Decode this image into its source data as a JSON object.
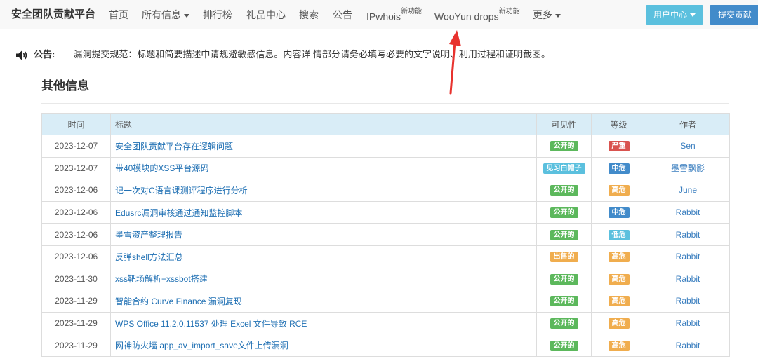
{
  "brand": "安全团队贡献平台",
  "nav": [
    {
      "label": "首页",
      "sup": "",
      "caret": false
    },
    {
      "label": "所有信息",
      "sup": "",
      "caret": true
    },
    {
      "label": "排行榜",
      "sup": "",
      "caret": false
    },
    {
      "label": "礼品中心",
      "sup": "",
      "caret": false
    },
    {
      "label": "搜索",
      "sup": "",
      "caret": false
    },
    {
      "label": "公告",
      "sup": "",
      "caret": false
    },
    {
      "label": "IPwhois",
      "sup": "新功能",
      "caret": false
    },
    {
      "label": "WooYun drops",
      "sup": "新功能",
      "caret": false
    },
    {
      "label": "更多",
      "sup": "",
      "caret": true
    }
  ],
  "user_center_label": "用户中心",
  "submit_label": "提交贡献",
  "notice": {
    "label": "公告:",
    "text": "漏洞提交规范：标题和简要描述中请规避敏感信息。内容详 情部分请务必填写必要的文字说明、利用过程和证明截图。"
  },
  "section_title": "其他信息",
  "table": {
    "headers": {
      "time": "时间",
      "title": "标题",
      "visibility": "可见性",
      "level": "等级",
      "author": "作者"
    },
    "rows": [
      {
        "time": "2023-12-07",
        "title": "安全团队贡献平台存在逻辑问题",
        "visibility": "公开的",
        "visibility_color": "#5cb85c",
        "level": "严重",
        "level_color": "#d9534f",
        "author": "Sen"
      },
      {
        "time": "2023-12-07",
        "title": "带40模块的XSS平台源码",
        "visibility": "见习白帽子",
        "visibility_color": "#5bc0de",
        "level": "中危",
        "level_color": "#428bca",
        "author": "墨雪飘影"
      },
      {
        "time": "2023-12-06",
        "title": "记一次对C语言课测评程序进行分析",
        "visibility": "公开的",
        "visibility_color": "#5cb85c",
        "level": "高危",
        "level_color": "#f0ad4e",
        "author": "June"
      },
      {
        "time": "2023-12-06",
        "title": "Edusrc漏洞审核通过通知监控脚本",
        "visibility": "公开的",
        "visibility_color": "#5cb85c",
        "level": "中危",
        "level_color": "#428bca",
        "author": "Rabbit"
      },
      {
        "time": "2023-12-06",
        "title": "墨雪资产整理报告",
        "visibility": "公开的",
        "visibility_color": "#5cb85c",
        "level": "低危",
        "level_color": "#5bc0de",
        "author": "Rabbit"
      },
      {
        "time": "2023-12-06",
        "title": "反弹shell方法汇总",
        "visibility": "出售的",
        "visibility_color": "#f0ad4e",
        "level": "高危",
        "level_color": "#f0ad4e",
        "author": "Rabbit"
      },
      {
        "time": "2023-11-30",
        "title": "xss靶场解析+xssbot搭建",
        "visibility": "公开的",
        "visibility_color": "#5cb85c",
        "level": "高危",
        "level_color": "#f0ad4e",
        "author": "Rabbit"
      },
      {
        "time": "2023-11-29",
        "title": "智能合约 Curve Finance 漏洞复现",
        "visibility": "公开的",
        "visibility_color": "#5cb85c",
        "level": "高危",
        "level_color": "#f0ad4e",
        "author": "Rabbit"
      },
      {
        "time": "2023-11-29",
        "title": "WPS Office 11.2.0.11537 处理 Excel 文件导致 RCE",
        "visibility": "公开的",
        "visibility_color": "#5cb85c",
        "level": "高危",
        "level_color": "#f0ad4e",
        "author": "Rabbit"
      },
      {
        "time": "2023-11-29",
        "title": "网神防火墙 app_av_import_save文件上传漏洞",
        "visibility": "公开的",
        "visibility_color": "#5cb85c",
        "level": "高危",
        "level_color": "#f0ad4e",
        "author": "Rabbit"
      }
    ]
  },
  "icons": {
    "notice": "speaker-icon",
    "dropdown": "caret-down-icon",
    "annotation": "red-arrow-annotation"
  },
  "colors": {
    "navbar_bg": "#f8f8f8",
    "table_header_bg": "#d9edf7",
    "link": "#1e6fb3",
    "annotation_red": "#e8322e"
  }
}
